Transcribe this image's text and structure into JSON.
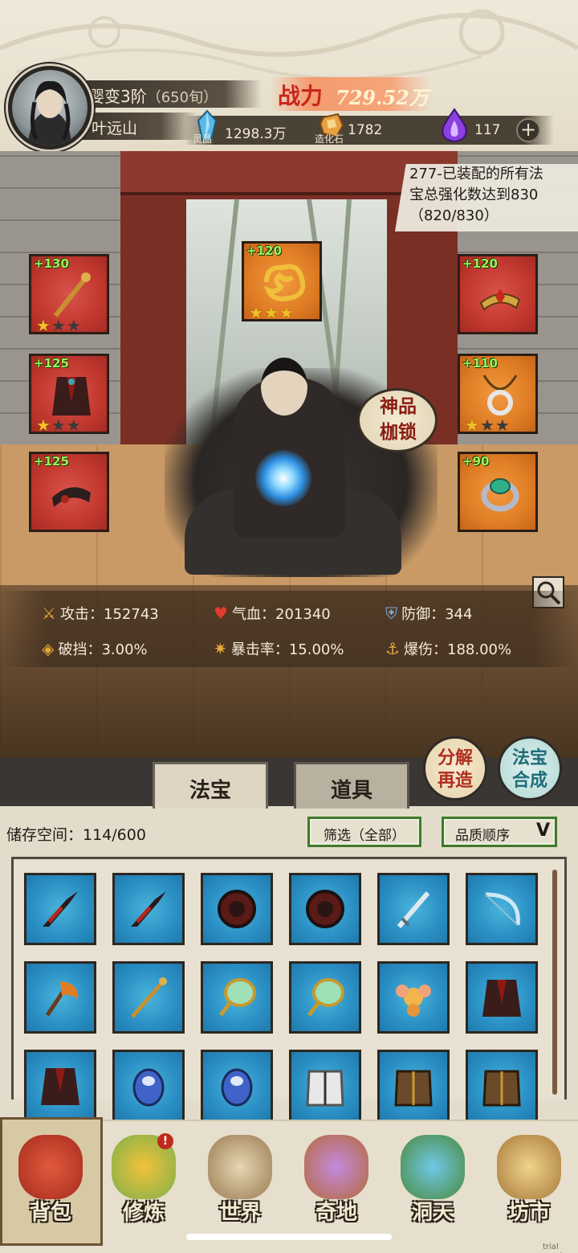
{
  "header": {
    "realm": "婴变3阶",
    "realm_age": "（650旬）",
    "player_name": "叶远山",
    "power_label": "战力",
    "power_value": "729.52万"
  },
  "resources": [
    {
      "name": "灵晶",
      "value": "1298.3万",
      "icon": "crystal-icon",
      "color": "#5bb8e8"
    },
    {
      "name": "造化石",
      "value": "1782",
      "icon": "stone-icon",
      "color": "#e6a040"
    },
    {
      "name": "",
      "value": "117",
      "icon": "spirit-flame-icon",
      "color": "#8a3fe0"
    }
  ],
  "quest": {
    "text_line1": "277-已装配的所有法",
    "text_line2": "宝总强化数达到830",
    "text_line3": "（820/830）"
  },
  "equipment": {
    "left": [
      {
        "level": "+130",
        "stars": 1,
        "max_stars": 3,
        "icon": "staff-icon",
        "quality": "red"
      },
      {
        "level": "+125",
        "stars": 1,
        "max_stars": 3,
        "icon": "robe-icon",
        "quality": "red"
      },
      {
        "level": "+125",
        "stars": 0,
        "max_stars": 3,
        "icon": "belt-icon",
        "quality": "red"
      }
    ],
    "top": {
      "level": "+120",
      "stars": 3,
      "max_stars": 3,
      "icon": "golden-cloud-icon",
      "quality": "orange"
    },
    "right": [
      {
        "level": "+120",
        "stars": 0,
        "max_stars": 3,
        "icon": "crown-icon",
        "quality": "red"
      },
      {
        "level": "+110",
        "stars": 1,
        "max_stars": 3,
        "icon": "necklace-icon",
        "quality": "orange"
      },
      {
        "level": "+90",
        "stars": 0,
        "max_stars": 3,
        "icon": "ring-icon",
        "quality": "orange"
      }
    ]
  },
  "lock_badge": {
    "line1": "神品",
    "line2": "枷锁"
  },
  "stats": [
    {
      "label": "攻击：152743",
      "icon": "sword-icon"
    },
    {
      "label": "气血：201340",
      "icon": "heart-icon"
    },
    {
      "label": "防御：344",
      "icon": "shield-icon"
    },
    {
      "label": "破挡：3.00%",
      "icon": "break-icon"
    },
    {
      "label": "暴击率：15.00%",
      "icon": "crit-icon"
    },
    {
      "label": "爆伤：188.00%",
      "icon": "crit-damage-icon"
    }
  ],
  "tabs": {
    "fabao": "法宝",
    "daoju": "道具"
  },
  "actions": {
    "fenjie_line1": "分解",
    "fenjie_line2": "再造",
    "hecheng_line1": "法宝",
    "hecheng_line2": "合成"
  },
  "storage": {
    "label": "储存空间：114/600"
  },
  "filters": {
    "all": "筛选（全部）",
    "quality": "品质顺序"
  },
  "inventory_items": [
    "dark-dagger-icon",
    "dark-dagger-icon",
    "spiked-wheel-icon",
    "spiked-wheel-icon",
    "jade-sword-icon",
    "jade-bow-icon",
    "flame-axe-icon",
    "staff-icon",
    "jade-mirror-icon",
    "jade-mirror-icon",
    "golden-flower-icon",
    "robe-icon",
    "robe-icon",
    "blue-vessel-icon",
    "blue-vessel-icon",
    "white-armor-icon",
    "brown-armor-icon",
    "brown-armor-icon"
  ],
  "nav": [
    {
      "label": "背包",
      "icon": "backpack-icon"
    },
    {
      "label": "修炼",
      "icon": "lotus-icon"
    },
    {
      "label": "世界",
      "icon": "scroll-map-icon"
    },
    {
      "label": "奇地",
      "icon": "pagoda-icon"
    },
    {
      "label": "洞天",
      "icon": "portal-icon"
    },
    {
      "label": "坊市",
      "icon": "market-icon"
    }
  ],
  "notification": "!",
  "watermark": "trial version"
}
